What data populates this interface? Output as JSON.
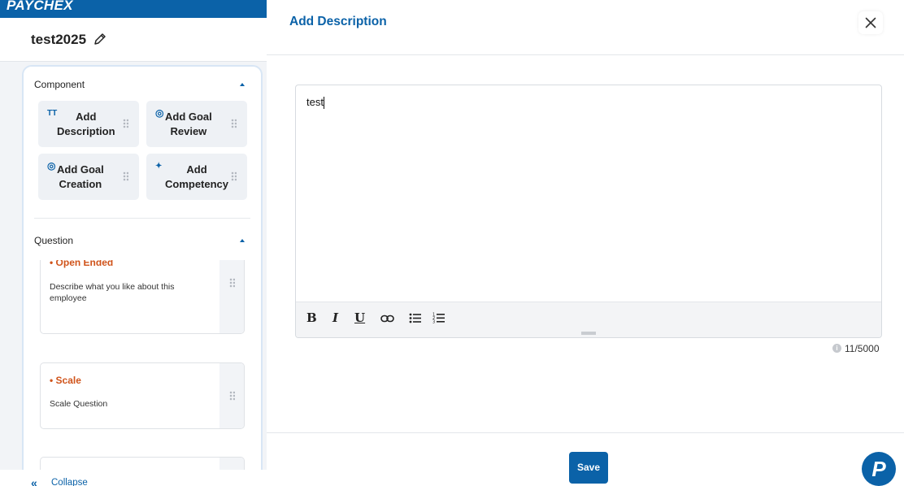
{
  "brand": {
    "logo_text": "PAYCHEX",
    "color": "#0b62a8"
  },
  "form": {
    "title": "test2025"
  },
  "sidebar": {
    "component_section": {
      "heading": "Component",
      "items": [
        {
          "icon_glyph": "TT",
          "icon": "text-icon",
          "label": "Add\nDescription"
        },
        {
          "icon_glyph": "◎",
          "icon": "target-icon",
          "label": "Add Goal\nReview"
        },
        {
          "icon_glyph": "◎",
          "icon": "target-icon",
          "label": "Add Goal\nCreation"
        },
        {
          "icon_glyph": "✦",
          "icon": "sparkle-icon",
          "label": "Add\nCompetency"
        }
      ]
    },
    "question_section": {
      "heading": "Question",
      "items": [
        {
          "type": "• Open Ended",
          "description": "Describe what you like about this employee"
        },
        {
          "type": "• Scale",
          "description": "Scale Question"
        }
      ]
    },
    "collapse_label": "Collapse"
  },
  "modal": {
    "title": "Add Description",
    "editor_value": "test",
    "toolbar": {
      "bold": "B",
      "italic": "I",
      "underline": "U"
    },
    "char_count": "11/5000",
    "save_label": "Save"
  },
  "accent_colors": {
    "question_type": "#d0541b",
    "primary": "#0b62a8"
  }
}
